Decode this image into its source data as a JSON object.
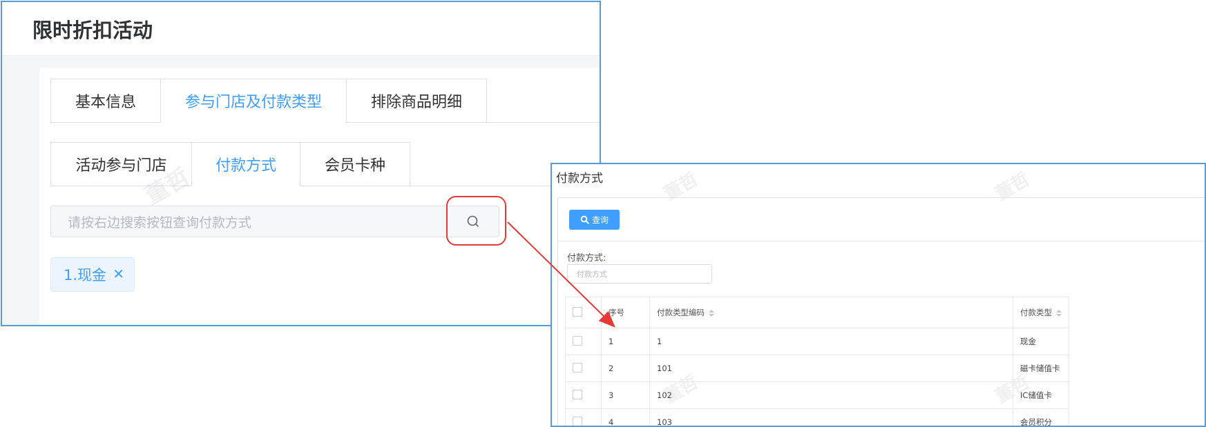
{
  "main": {
    "title": "限时折扣活动",
    "tabs": [
      {
        "label": "基本信息"
      },
      {
        "label": "参与门店及付款类型"
      },
      {
        "label": "排除商品明细"
      }
    ],
    "subtabs": [
      {
        "label": "活动参与门店"
      },
      {
        "label": "付款方式"
      },
      {
        "label": "会员卡种"
      }
    ],
    "search": {
      "placeholder": "请按右边搜索按钮查询付款方式"
    },
    "tag": {
      "label": "1.现金",
      "close": "✕"
    },
    "watermark": "董哲",
    "accent_color": "#409eff"
  },
  "dialog": {
    "title": "付款方式",
    "query_button": "查询",
    "field_label": "付款方式:",
    "field_placeholder": "付款方式",
    "columns": [
      "序号",
      "付款类型编码",
      "付款类型"
    ],
    "rows": [
      {
        "no": "1",
        "code": "1",
        "type": "现金"
      },
      {
        "no": "2",
        "code": "101",
        "type": "磁卡储值卡"
      },
      {
        "no": "3",
        "code": "102",
        "type": "IC储值卡"
      },
      {
        "no": "4",
        "code": "103",
        "type": "会员积分"
      }
    ],
    "annotation_color": "#e53935"
  }
}
